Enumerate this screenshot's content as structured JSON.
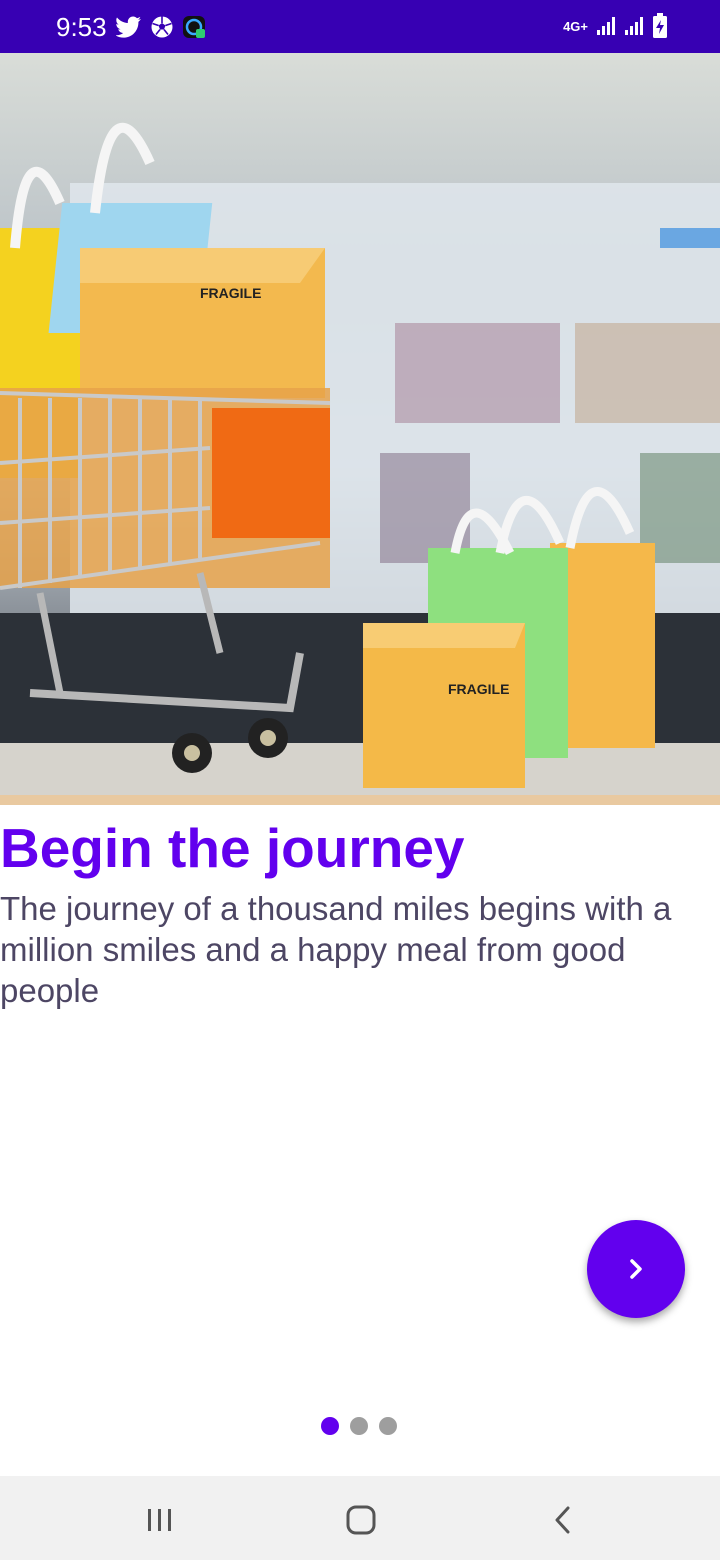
{
  "status_bar": {
    "time": "9:53",
    "network": "4G+",
    "left_icons": [
      "twitter-icon",
      "soccer-ball-icon",
      "app-notification-icon"
    ],
    "right_icons": [
      "signal-icon",
      "signal-icon",
      "battery-charging-icon"
    ]
  },
  "onboarding": {
    "headline": "Begin the journey",
    "body": "The journey of a thousand miles begins with a million smiles and a happy meal from good people",
    "next_button_icon": "chevron-right-icon",
    "page_count": 3,
    "current_page": 1,
    "box_label": "FRAGILE"
  },
  "colors": {
    "status_bar": "#3700b3",
    "accent": "#6200ee",
    "body_text": "#4d4664",
    "dot_inactive": "#9e9e9e",
    "nav_bar": "#f1f1f1"
  },
  "nav_bar": {
    "buttons": [
      "recent-apps-icon",
      "home-icon",
      "back-icon"
    ]
  }
}
